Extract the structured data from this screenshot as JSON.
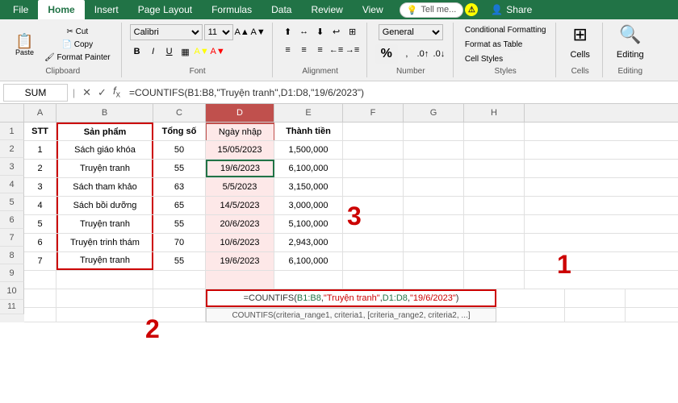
{
  "ribbon": {
    "tabs": [
      "File",
      "Home",
      "Insert",
      "Page Layout",
      "Formulas",
      "Data",
      "Review",
      "View"
    ],
    "active_tab": "Home",
    "tell_me": "Tell me...",
    "share": "Share",
    "warn_icon": "⚠"
  },
  "clipboard": {
    "label": "Clipboard",
    "paste_label": "Paste"
  },
  "font": {
    "label": "Font",
    "family": "Calibri",
    "size": "11",
    "bold": "B",
    "italic": "I",
    "underline": "U"
  },
  "alignment": {
    "label": "Alignment"
  },
  "number": {
    "label": "Number",
    "percent": "%"
  },
  "styles": {
    "label": "Styles",
    "conditional": "Conditional Formatting",
    "format_as": "Format as Table",
    "cell_styles": "Cell Styles"
  },
  "cells": {
    "label": "Cells",
    "text": "Cells"
  },
  "editing": {
    "label": "Editing",
    "text": "Editing"
  },
  "formula_bar": {
    "name_box": "SUM",
    "formula": "=COUNTIFS(B1:B8,\"Truyện tranh\",D1:D8,\"19/6/2023\")"
  },
  "columns": {
    "headers": [
      "A",
      "B",
      "C",
      "D",
      "E",
      "F",
      "G",
      "H"
    ]
  },
  "rows": [
    {
      "num": "1",
      "a": "STT",
      "b": "Sản phẩm",
      "c": "Tổng số",
      "d": "Ngày nhập",
      "e": "Thành tiền",
      "f": "",
      "g": "",
      "h": ""
    },
    {
      "num": "2",
      "a": "1",
      "b": "Sách giáo khóa",
      "c": "50",
      "d": "15/05/2023",
      "e": "1,500,000",
      "f": "",
      "g": "",
      "h": ""
    },
    {
      "num": "3",
      "a": "2",
      "b": "Truyện tranh",
      "c": "55",
      "d": "19/6/2023",
      "e": "6,100,000",
      "f": "",
      "g": "",
      "h": ""
    },
    {
      "num": "4",
      "a": "3",
      "b": "Sách tham khảo",
      "c": "63",
      "d": "5/5/2023",
      "e": "3,150,000",
      "f": "",
      "g": "",
      "h": ""
    },
    {
      "num": "5",
      "a": "4",
      "b": "Sách bồi dưỡng",
      "c": "65",
      "d": "14/5/2023",
      "e": "3,000,000",
      "f": "",
      "g": "",
      "h": ""
    },
    {
      "num": "6",
      "a": "5",
      "b": "Truyện tranh",
      "c": "55",
      "d": "20/6/2023",
      "e": "5,100,000",
      "f": "",
      "g": "",
      "h": ""
    },
    {
      "num": "7",
      "a": "6",
      "b": "Truyện trinh thám",
      "c": "70",
      "d": "10/6/2023",
      "e": "2,943,000",
      "f": "",
      "g": "",
      "h": ""
    },
    {
      "num": "8",
      "a": "7",
      "b": "Truyện tranh",
      "c": "55",
      "d": "19/6/2023",
      "e": "6,100,000",
      "f": "",
      "g": "",
      "h": ""
    },
    {
      "num": "9",
      "a": "",
      "b": "",
      "c": "",
      "d": "",
      "e": "",
      "f": "",
      "g": "",
      "h": ""
    },
    {
      "num": "10",
      "a": "",
      "b": "",
      "c": "",
      "d": "=COUNTIFS(B1:B8,\"Truyện tranh\",D1:D8,\"19/6/2023\")",
      "e": "",
      "f": "",
      "g": "",
      "h": ""
    },
    {
      "num": "11",
      "a": "",
      "b": "",
      "c": "",
      "d": "COUNTIFS(criteria_range1, criteria1, [criteria_range2, criteria2, ...]",
      "e": "",
      "f": "",
      "g": "",
      "h": ""
    }
  ],
  "annotations": {
    "anno1": "1",
    "anno2": "2",
    "anno3": "3"
  }
}
